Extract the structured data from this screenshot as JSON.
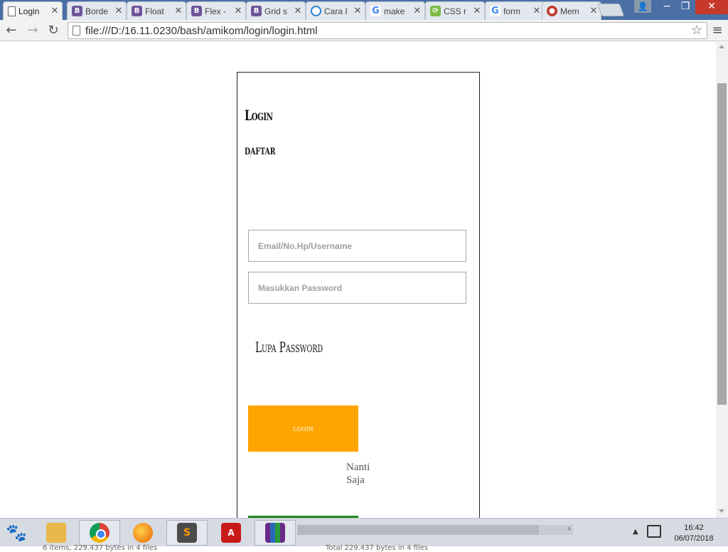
{
  "tabs": [
    {
      "title": "Login",
      "favicon": "page-icon",
      "color": "#ffffff",
      "active": true
    },
    {
      "title": "Borde",
      "favicon": "B",
      "color": "#6f5499"
    },
    {
      "title": "Float",
      "favicon": "B",
      "color": "#6f5499"
    },
    {
      "title": "Flex -",
      "favicon": "B",
      "color": "#6f5499"
    },
    {
      "title": "Grid s",
      "favicon": "B",
      "color": "#6f5499"
    },
    {
      "title": "Cara I",
      "favicon": "cara-icon",
      "color": "#2a7fd1"
    },
    {
      "title": "make",
      "favicon": "G",
      "color": "#4285f4"
    },
    {
      "title": "CSS r",
      "favicon": "css-icon",
      "color": "#7cbb47"
    },
    {
      "title": "form",
      "favicon": "G",
      "color": "#4285f4"
    },
    {
      "title": "Mem",
      "favicon": "mem-icon",
      "color": "#c0392b"
    }
  ],
  "browser": {
    "url": "file:///D:/16.11.0230/bash/amikom/login/login.html"
  },
  "page": {
    "heading_login": "Login",
    "heading_daftar": "daftar",
    "email_placeholder": "Email/No.Hp/Username",
    "password_placeholder": "Masukkan Password",
    "forgot_label": "Lupa Password",
    "login_button": "login",
    "later_text": "Nanti Saja",
    "colors": {
      "login_button": "#ffa500",
      "green_button": "#1f8a1f"
    }
  },
  "taskbar": {
    "clock_time": "16:42",
    "clock_date": "06/07/2018",
    "status_left": "6 items, 229.437 bytes in 4 files",
    "status_right": "Total 229.437 bytes in 4 files"
  }
}
